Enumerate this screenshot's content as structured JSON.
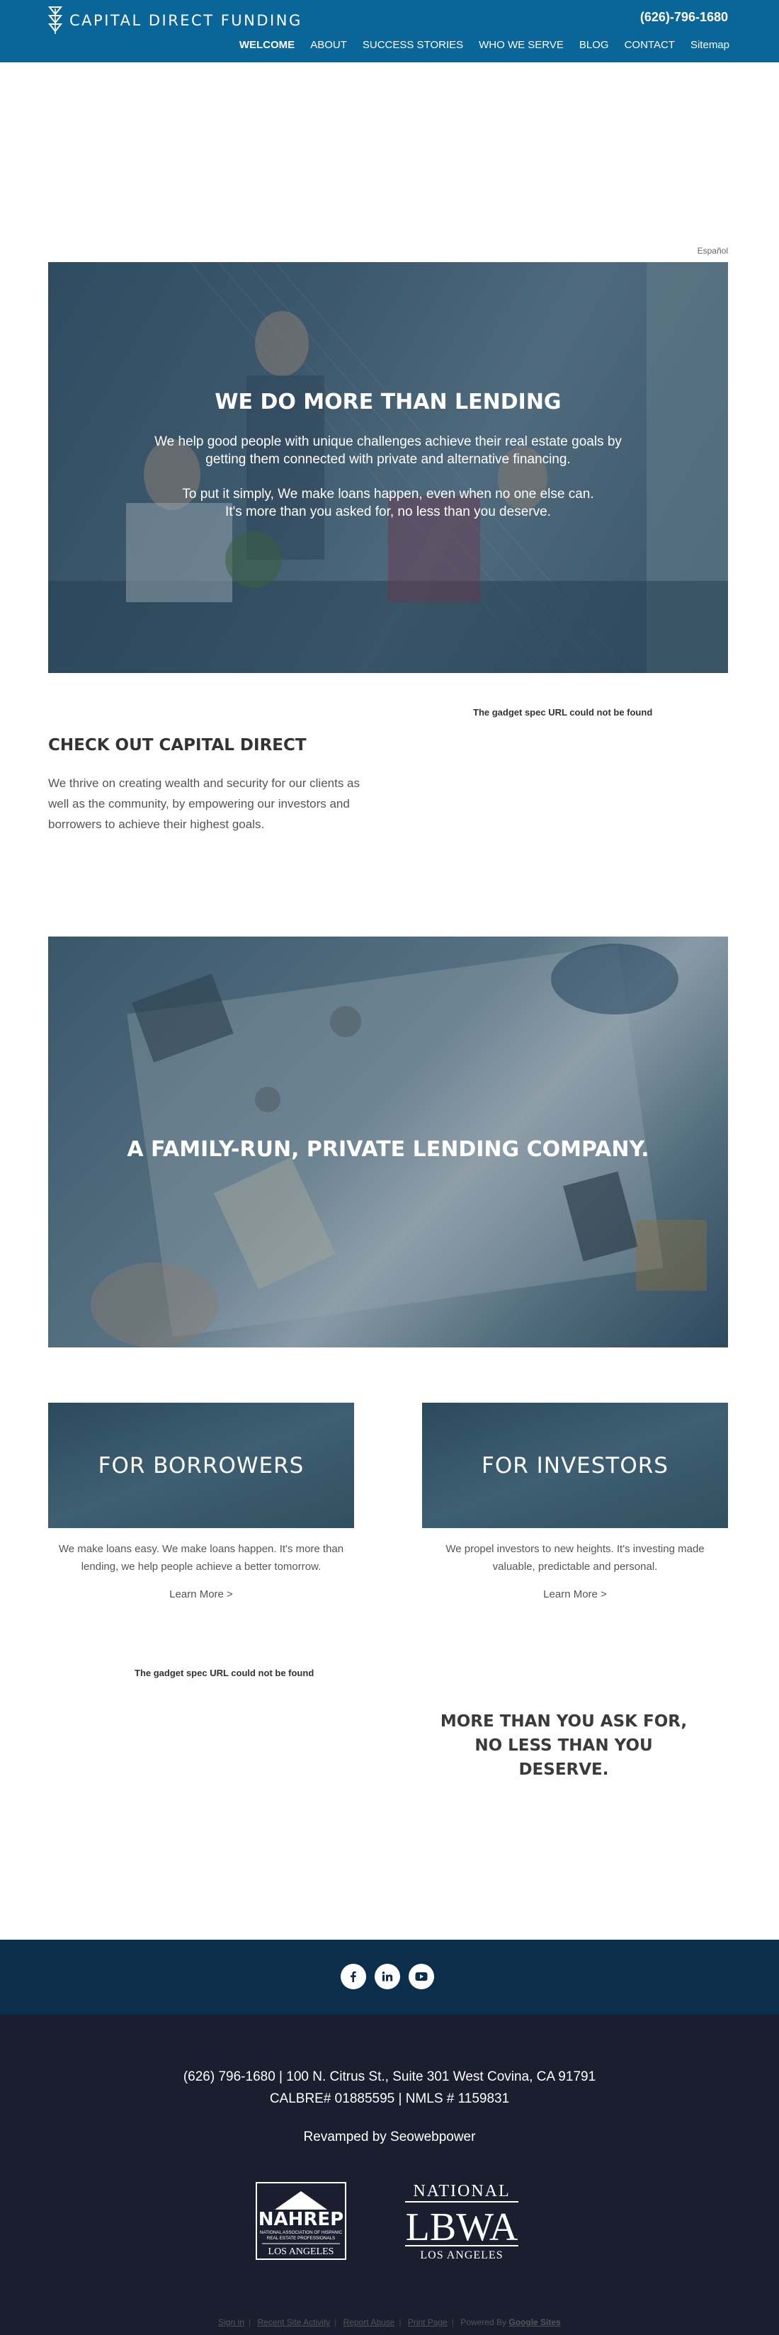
{
  "header": {
    "logo_text": "CAPITAL DIRECT FUNDING",
    "phone": "(626)-796-1680",
    "nav": [
      "WELCOME",
      "ABOUT",
      "SUCCESS STORIES",
      "WHO WE SERVE",
      "BLOG",
      "CONTACT",
      "Sitemap"
    ]
  },
  "language_link": "Español",
  "hero": {
    "title": "WE DO MORE THAN LENDING",
    "line1": "We help good people with unique challenges achieve their real estate goals by",
    "line2": "getting them connected with private and alternative financing.",
    "line3": "To put it simply, We make loans happen, even when no one else can.",
    "line4": "It's more than you asked for, no less than you deserve."
  },
  "gadget_error": "The gadget spec URL could not be found",
  "check_out": {
    "title": "CHECK OUT CAPITAL DIRECT",
    "text": "We thrive on creating wealth and security for our clients as well as the community, by empowering our investors and borrowers to achieve their highest goals."
  },
  "family_title": "A FAMILY-RUN, PRIVATE LENDING COMPANY.",
  "cards": [
    {
      "title": "FOR BORROWERS",
      "text": "We make loans easy. We make loans happen. It's more than lending, we help people achieve a better tomorrow.",
      "link": "Learn More >"
    },
    {
      "title": "FOR INVESTORS",
      "text": "We propel investors to new heights. It's investing made valuable, predictable and personal.",
      "link": "Learn More >"
    }
  ],
  "more_than": [
    "MORE THAN YOU ASK FOR,",
    "NO LESS THAN YOU",
    "DESERVE."
  ],
  "social": [
    "facebook-icon",
    "linkedin-icon",
    "youtube-icon"
  ],
  "footer": {
    "address": "(626) 796-1680 | 100 N. Citrus St., Suite 301 West Covina, CA 91791",
    "license": "CALBRE# 01885595 | NMLS # 1159831",
    "revamped": "Revamped by Seowebpower",
    "nahrep_big": "NAHREP",
    "nahrep_small1": "NATIONAL ASSOCIATION OF HISPANIC",
    "nahrep_small2": "REAL ESTATE PROFESSIONALS",
    "nahrep_city": "LOS ANGELES",
    "lbwa_top": "NATIONAL",
    "lbwa_big": "LBWA",
    "lbwa_city": "LOS ANGELES",
    "bottom_links": [
      "Sign in",
      "Recent Site Activity",
      "Report Abuse",
      "Print Page"
    ],
    "powered_by": "Powered By",
    "google_sites": "Google Sites"
  },
  "colors": {
    "header": "#0a6699",
    "social_band": "#0b2f4b",
    "footer": "#1b1e2e"
  }
}
